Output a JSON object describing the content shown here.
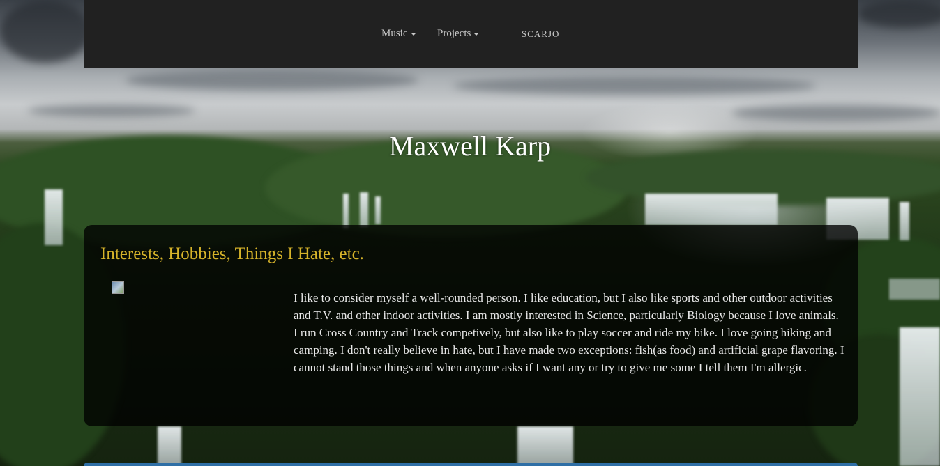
{
  "nav": {
    "items": [
      {
        "label": "Music"
      },
      {
        "label": "Projects"
      }
    ],
    "brand": "SCARJO"
  },
  "hero": {
    "title": "Maxwell Karp"
  },
  "section": {
    "heading": "Interests, Hobbies, Things I Hate, etc.",
    "body": "I like to consider myself a well-rounded person. I like education, but I also like sports and other outdoor activities and T.V. and other indoor activities. I am mostly interested in Science, particularly Biology because I love animals. I run Cross Country and Track competively, but also like to play soccer and ride my bike. I love going hiking and camping. I don't really believe in hate, but I have made two exceptions: fish(as food) and artificial grape flavoring. I cannot stand those things and when anyone asks if I want any or try to give me some I tell them I'm allergic."
  },
  "colors": {
    "navbar_bg": "#212121",
    "heading_gold": "#d6b32a",
    "panel_bg": "rgba(0,0,0,0.78)",
    "accent_blue": "#2f6fa6"
  },
  "icons": {
    "broken_image": "broken-image-icon",
    "dropdown": "caret-down-icon"
  }
}
